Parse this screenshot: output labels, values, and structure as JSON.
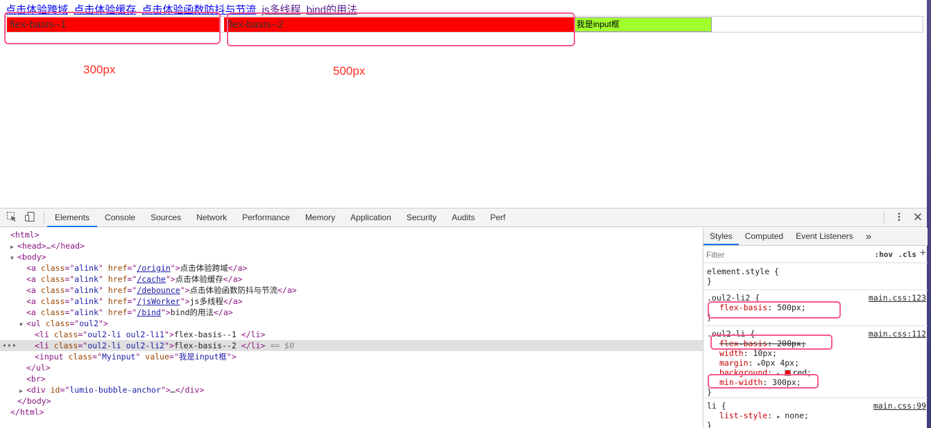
{
  "page": {
    "links": [
      "点击体验跨域",
      "点击体验缓存",
      "点击体验函数防抖与节流",
      "js多线程",
      "bind的用法"
    ],
    "items": [
      "flex-basis--1",
      "flex-basis--2"
    ],
    "input_value": "我是input框",
    "annotations": [
      "300px",
      "500px"
    ]
  },
  "devtools": {
    "tabs": [
      "Elements",
      "Console",
      "Sources",
      "Network",
      "Performance",
      "Memory",
      "Application",
      "Security",
      "Audits",
      "Perf"
    ],
    "active_tab": "Elements",
    "dom": {
      "html_open": "<html>",
      "head": "<head>…</head>",
      "body_open": "<body>",
      "a_links": [
        {
          "href": "/origin",
          "text": "点击体验跨域"
        },
        {
          "href": "/cache",
          "text": "点击体验缓存"
        },
        {
          "href": "/debounce",
          "text": "点击体验函数防抖与节流"
        },
        {
          "href": "/jsWorker",
          "text": "js多线程"
        },
        {
          "href": "/bind",
          "text": "bind的用法"
        }
      ],
      "a_class": "alink",
      "ul_class": "oul2",
      "li1_class": "oul2-li oul2-li1",
      "li1_text": "flex-basis--1 ",
      "li2_class": "oul2-li oul2-li2",
      "li2_text": "flex-basis--2 ",
      "selected_marker": "== $0",
      "input_class": "Myinput",
      "input_value": "我是input框",
      "div_id": "lumio-bubble-anchor",
      "ellipsis": "…"
    },
    "styles": {
      "tabs": [
        "Styles",
        "Computed",
        "Event Listeners"
      ],
      "active_tab": "Styles",
      "filter_placeholder": "Filter",
      "hov": ":hov",
      "cls": ".cls",
      "element_style": "element.style {",
      "close_brace": "}",
      "rule1": {
        "selector": ".oul2-li2 {",
        "source": "main.css:123",
        "prop": "flex-basis",
        "value": "500px;"
      },
      "rule2": {
        "selector": ".oul2-li {",
        "source": "main.css:112",
        "props": [
          {
            "prop": "flex-basis",
            "value": "200px;"
          },
          {
            "prop": "width",
            "value": "10px;"
          },
          {
            "prop": "margin",
            "value": "0px 4px;"
          },
          {
            "prop": "background",
            "value": "red;"
          },
          {
            "prop": "min-width",
            "value": "300px;"
          }
        ]
      },
      "rule3": {
        "selector": "li {",
        "source": "main.css:99",
        "prop": "list-style",
        "value": "none;"
      }
    }
  }
}
